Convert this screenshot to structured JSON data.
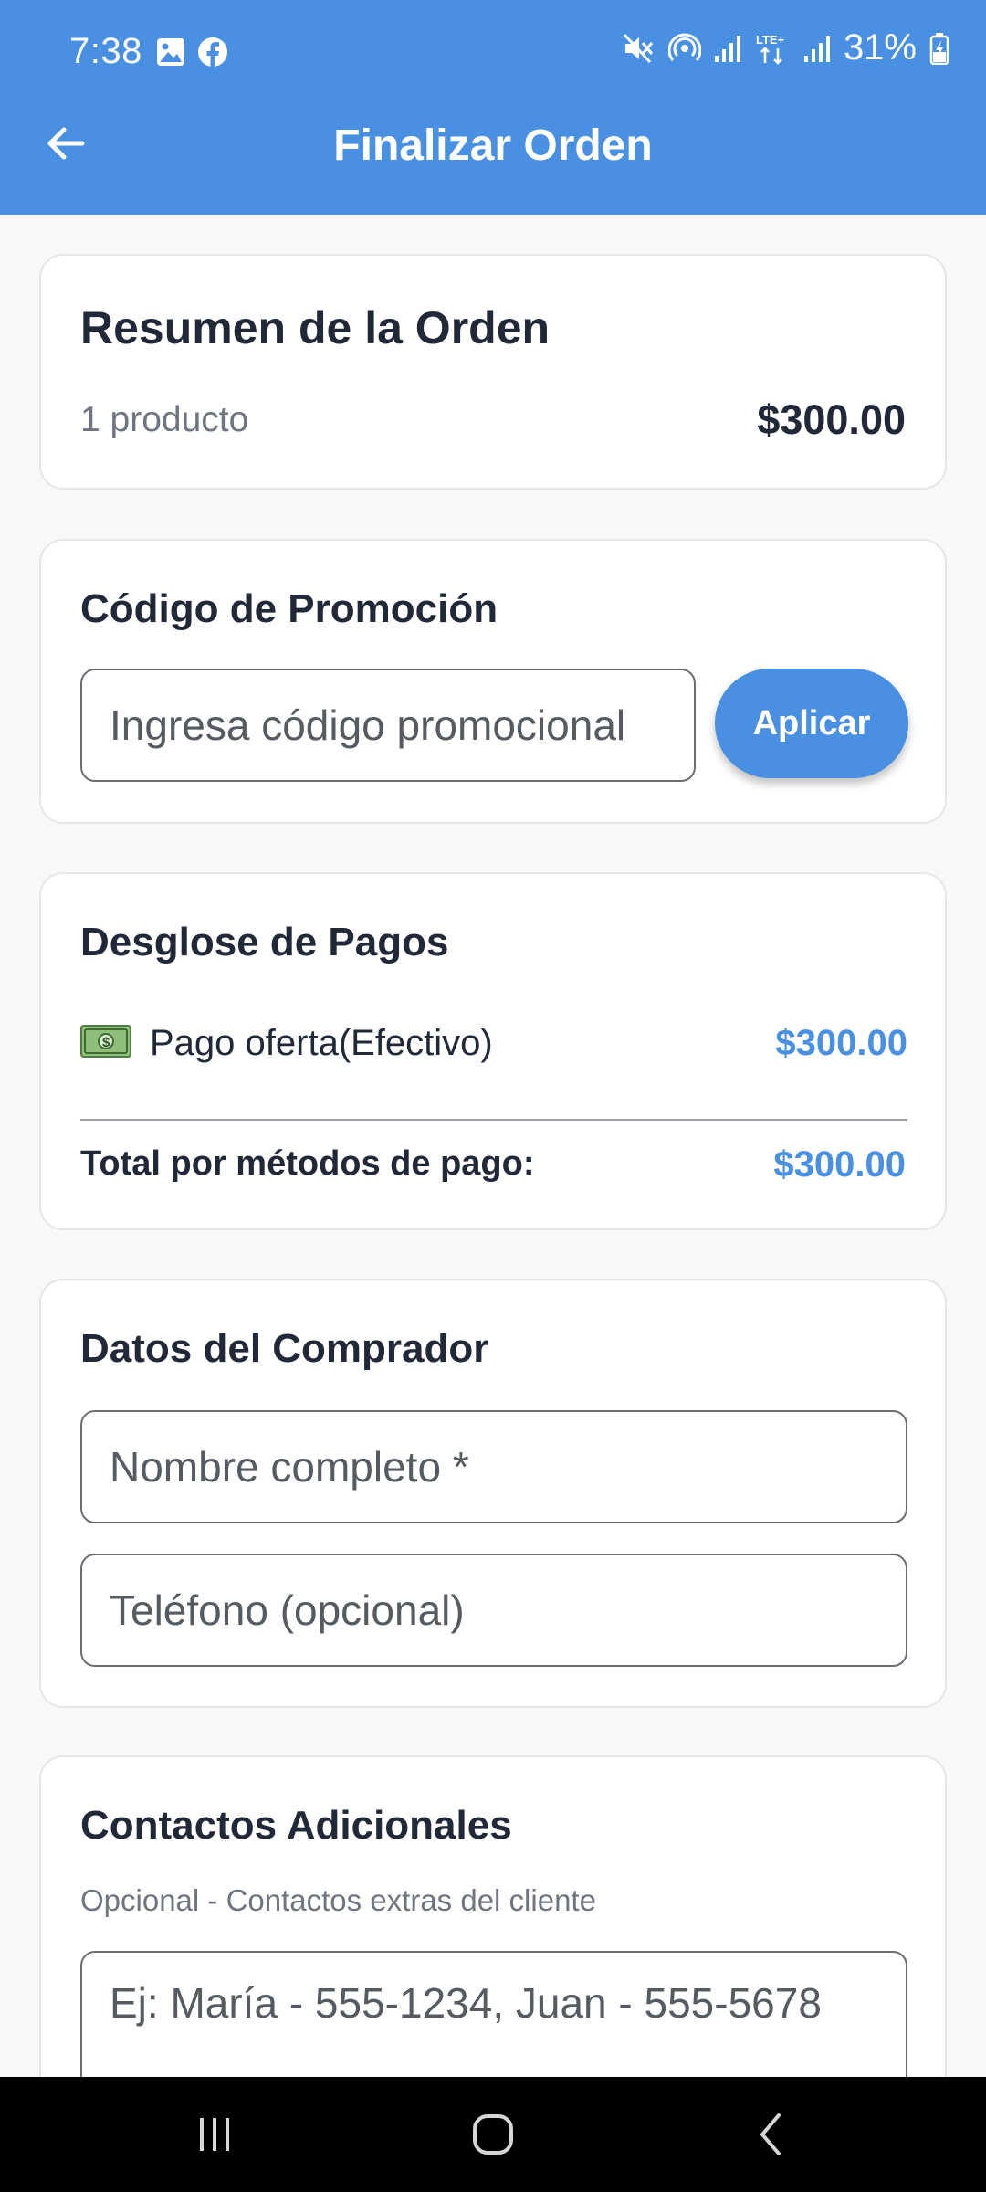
{
  "status_bar": {
    "time": "7:38",
    "battery": "31%",
    "left_icons": [
      "image-icon",
      "facebook-icon"
    ],
    "right_icons": [
      "mute-icon",
      "hotspot-icon",
      "signal-icon",
      "lte-icon",
      "signal-icon",
      "battery-charging-icon"
    ]
  },
  "app_bar": {
    "title": "Finalizar Orden",
    "back_icon": "arrow-back-icon"
  },
  "order_summary": {
    "title": "Resumen de la Orden",
    "count": "1 producto",
    "amount": "$300.00"
  },
  "promo": {
    "title": "Código de Promoción",
    "placeholder": "Ingresa código promocional",
    "button": "Aplicar"
  },
  "payments": {
    "title": "Desglose de Pagos",
    "items": [
      {
        "icon": "cash-icon",
        "label": "Pago oferta(Efectivo)",
        "amount": "$300.00"
      }
    ],
    "total_label": "Total por métodos de pago:",
    "total_amount": "$300.00"
  },
  "buyer": {
    "title": "Datos del Comprador",
    "name_placeholder": "Nombre completo *",
    "phone_placeholder": "Teléfono (opcional)"
  },
  "contacts": {
    "title": "Contactos Adicionales",
    "subtitle": "Opcional - Contactos extras del cliente",
    "placeholder": "Ej: María - 555-1234, Juan - 555-5678"
  },
  "colors": {
    "primary": "#4a90e2",
    "text_dark": "#212837",
    "text_muted": "#6f7480",
    "background": "#f8f8f8"
  }
}
